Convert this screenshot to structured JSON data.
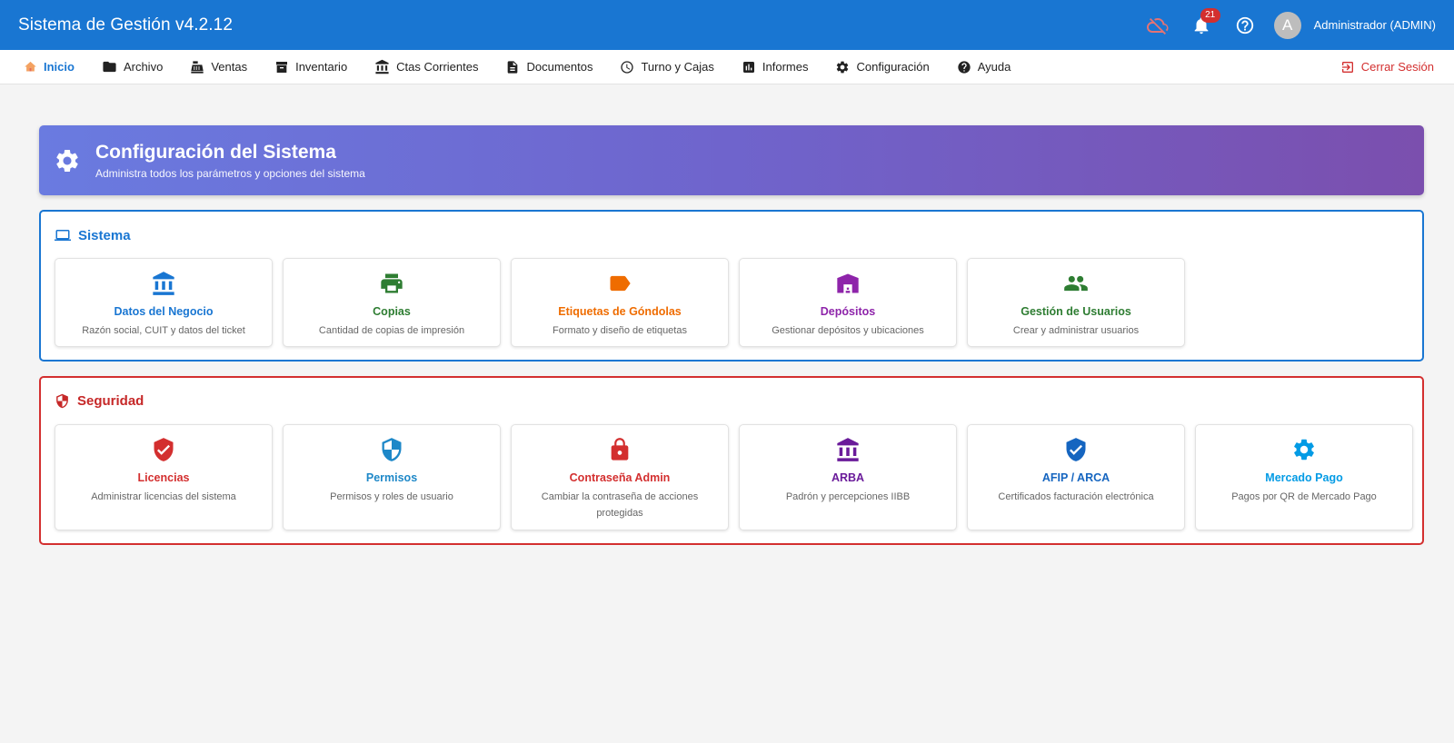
{
  "app": {
    "title": "Sistema de Gestión v4.2.12",
    "notifications_count": "21",
    "avatar_letter": "A",
    "user_name": "Administrador (ADMIN)"
  },
  "menu": {
    "items": [
      {
        "label": "Inicio",
        "icon": "home-icon"
      },
      {
        "label": "Archivo",
        "icon": "folder-icon"
      },
      {
        "label": "Ventas",
        "icon": "cash-register-icon"
      },
      {
        "label": "Inventario",
        "icon": "archive-box-icon"
      },
      {
        "label": "Ctas Corrientes",
        "icon": "bank-icon"
      },
      {
        "label": "Documentos",
        "icon": "document-icon"
      },
      {
        "label": "Turno y Cajas",
        "icon": "clock-icon"
      },
      {
        "label": "Informes",
        "icon": "bar-chart-icon"
      },
      {
        "label": "Configuración",
        "icon": "gear-icon"
      },
      {
        "label": "Ayuda",
        "icon": "help-icon"
      }
    ],
    "logout": "Cerrar Sesión"
  },
  "banner": {
    "title": "Configuración del Sistema",
    "subtitle": "Administra todos los parámetros y opciones del sistema"
  },
  "sistema": {
    "title": "Sistema",
    "cards": [
      {
        "title": "Datos del Negocio",
        "desc": "Razón social, CUIT y datos del ticket",
        "icon": "bank-icon",
        "color": "#1976d2"
      },
      {
        "title": "Copias",
        "desc": "Cantidad de copias de impresión",
        "icon": "printer-icon",
        "color": "#2e7d32"
      },
      {
        "title": "Etiquetas de Góndolas",
        "desc": "Formato y diseño de etiquetas",
        "icon": "label-icon",
        "color": "#ef6c00"
      },
      {
        "title": "Depósitos",
        "desc": "Gestionar depósitos y ubicaciones",
        "icon": "warehouse-icon",
        "color": "#8e24aa"
      },
      {
        "title": "Gestión de Usuarios",
        "desc": "Crear y administrar usuarios",
        "icon": "users-icon",
        "color": "#2e7d32"
      }
    ]
  },
  "seguridad": {
    "title": "Seguridad",
    "cards": [
      {
        "title": "Licencias",
        "desc": "Administrar licencias del sistema",
        "icon": "shield-check-icon",
        "color": "#d32f2f"
      },
      {
        "title": "Permisos",
        "desc": "Permisos y roles de usuario",
        "icon": "shield-icon",
        "color": "#1e88c8"
      },
      {
        "title": "Contraseña Admin",
        "desc": "Cambiar la contraseña de acciones protegidas",
        "icon": "lock-icon",
        "color": "#d32f2f"
      },
      {
        "title": "ARBA",
        "desc": "Padrón y percepciones IIBB",
        "icon": "bank-icon",
        "color": "#6a1b9a"
      },
      {
        "title": "AFIP / ARCA",
        "desc": "Certificados facturación electrónica",
        "icon": "shield-check-icon",
        "color": "#1565c0"
      },
      {
        "title": "Mercado Pago",
        "desc": "Pagos por QR de Mercado Pago",
        "icon": "gear-icon",
        "color": "#039be5"
      }
    ]
  },
  "colors": {
    "appbar": "#1976d2",
    "sistema_border": "#1976d2",
    "seguridad_border": "#d32f2f",
    "logout": "#d32f2f"
  }
}
